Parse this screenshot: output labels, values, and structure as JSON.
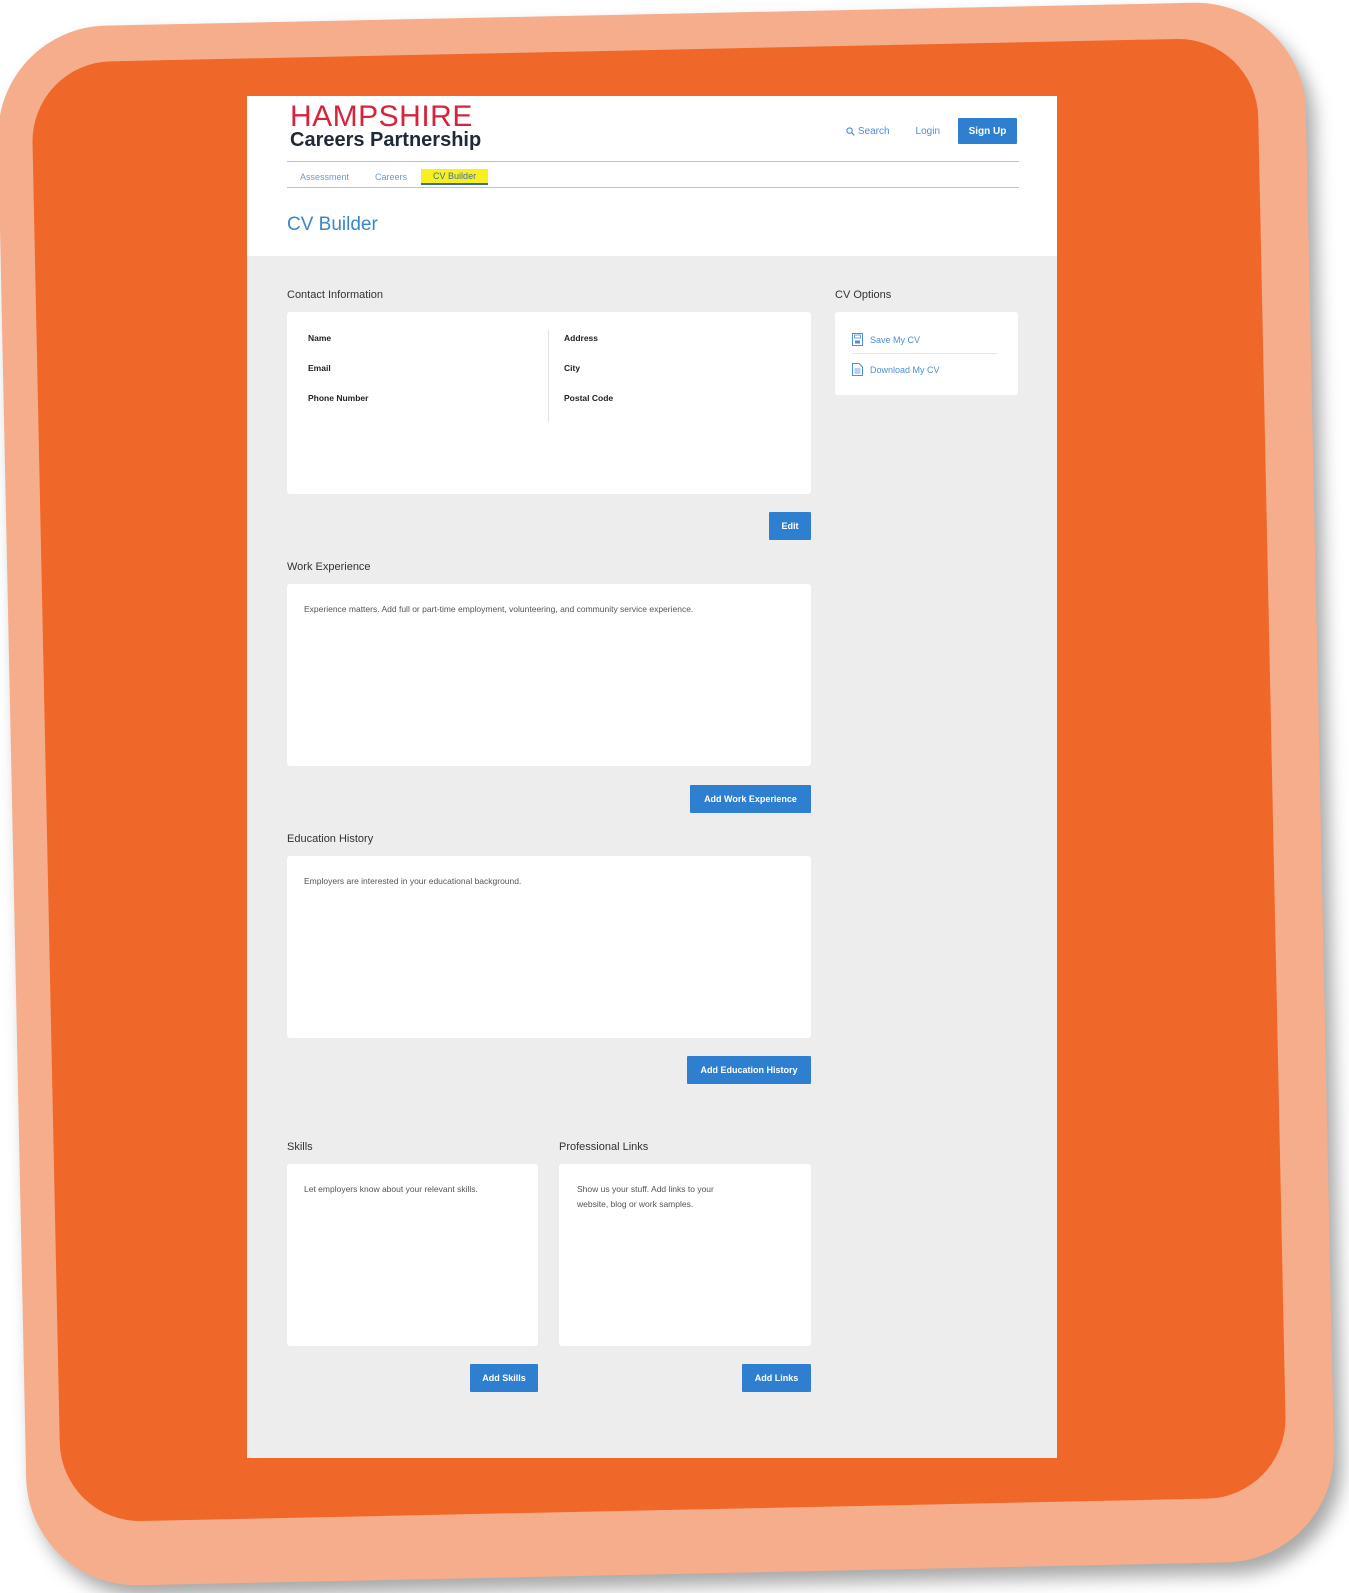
{
  "brand": {
    "line1": "HAMPSHIRE",
    "line2": "Careers Partnership",
    "accent_color": "#d6243b"
  },
  "header": {
    "search_label": "Search",
    "login_label": "Login",
    "signup_label": "Sign Up"
  },
  "tabs": [
    {
      "label": "Assessment"
    },
    {
      "label": "Careers"
    },
    {
      "label": "CV Builder",
      "active": true
    }
  ],
  "page_title": "CV Builder",
  "contact": {
    "heading": "Contact Information",
    "fields_left": [
      "Name",
      "Email",
      "Phone Number"
    ],
    "fields_right": [
      "Address",
      "City",
      "Postal Code"
    ],
    "edit_label": "Edit"
  },
  "work": {
    "heading": "Work Experience",
    "text": "Experience matters. Add full or part-time employment, volunteering, and community service experience.",
    "button": "Add Work Experience"
  },
  "education": {
    "heading": "Education History",
    "text": "Employers are interested in your educational background.",
    "button": "Add Education History"
  },
  "skills": {
    "heading": "Skills",
    "text": "Let employers know about your relevant skills.",
    "button": "Add Skills"
  },
  "links": {
    "heading": "Professional Links",
    "text": "Show us your stuff. Add links to your website, blog or work samples.",
    "button": "Add Links"
  },
  "cv_options": {
    "heading": "CV Options",
    "items": [
      {
        "label": "Save My CV",
        "icon": "save-icon"
      },
      {
        "label": "Download My CV",
        "icon": "document-icon"
      }
    ]
  },
  "colors": {
    "button": "#2f7fd1",
    "frame_outer": "#f6ad8c",
    "frame_inner": "#f0672a",
    "tab_highlight": "#f8ef21"
  }
}
